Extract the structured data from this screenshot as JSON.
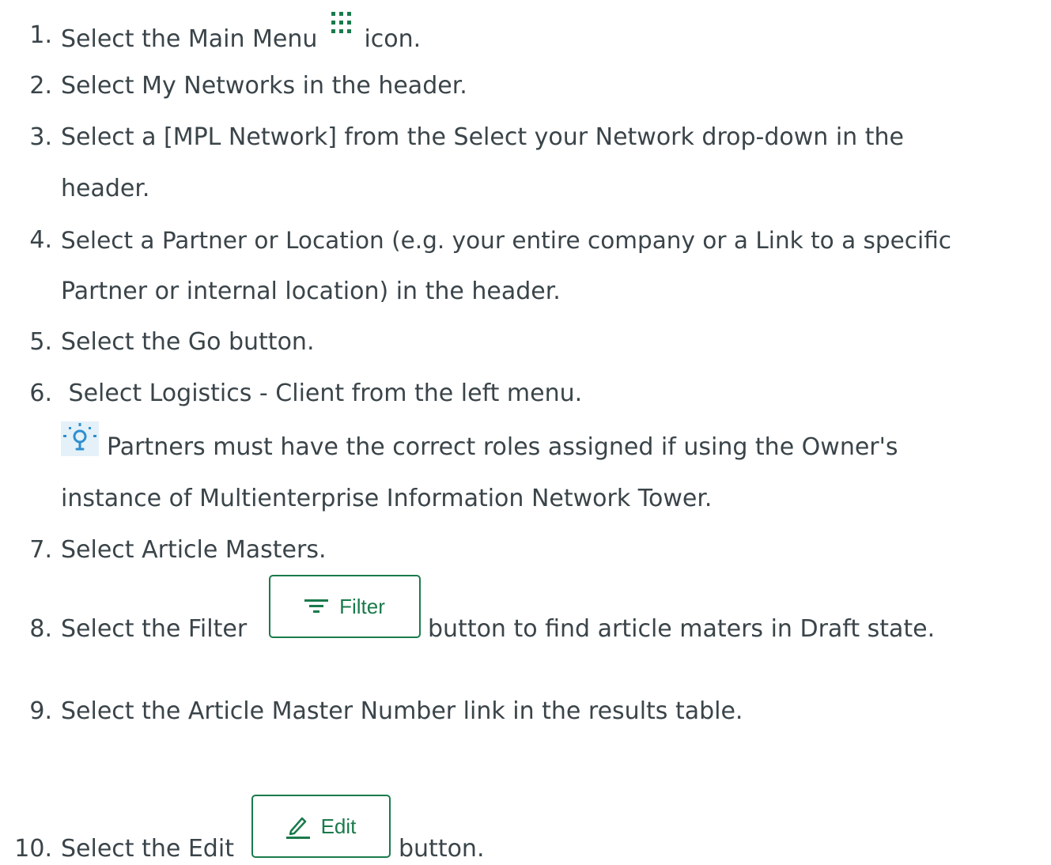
{
  "colors": {
    "text": "#3a4449",
    "accent": "#1a7a4c",
    "tip_bg": "#e4f1f9",
    "tip_icon": "#2e8fd0"
  },
  "steps": [
    {
      "num": "1.",
      "pre": "Select the Main Menu",
      "icon": "grid-dots-icon",
      "post": "icon."
    },
    {
      "num": "2.",
      "text": "Select My Networks in the header."
    },
    {
      "num": "3.",
      "text": "Select a [MPL Network] from the Select your Network drop-down in the",
      "cont": "header."
    },
    {
      "num": "4.",
      "text": "Select a Partner or Location (e.g. your entire company or a Link to a specific",
      "cont": "Partner or internal location) in the header."
    },
    {
      "num": "5.",
      "text": "Select the Go button."
    },
    {
      "num": "6.",
      "text": " Select Logistics - Client from the left menu.",
      "tip_line1": "Partners must have the correct roles assigned if using the Owner's",
      "tip_line2": "instance of Multienterprise Information Network Tower.",
      "tip_icon": "lightbulb-icon"
    },
    {
      "num": "7.",
      "text": "Select Article Masters."
    },
    {
      "num": "8.",
      "pre": "Select the Filter",
      "button_label": "Filter",
      "button_icon": "filter-icon",
      "post": "button to find article maters in Draft state."
    },
    {
      "num": "9.",
      "text": "Select the Article Master Number link in the results table."
    },
    {
      "num": "10.",
      "pre": "Select the Edit",
      "button_label": "Edit",
      "button_icon": "pencil-icon",
      "post": "button."
    }
  ]
}
